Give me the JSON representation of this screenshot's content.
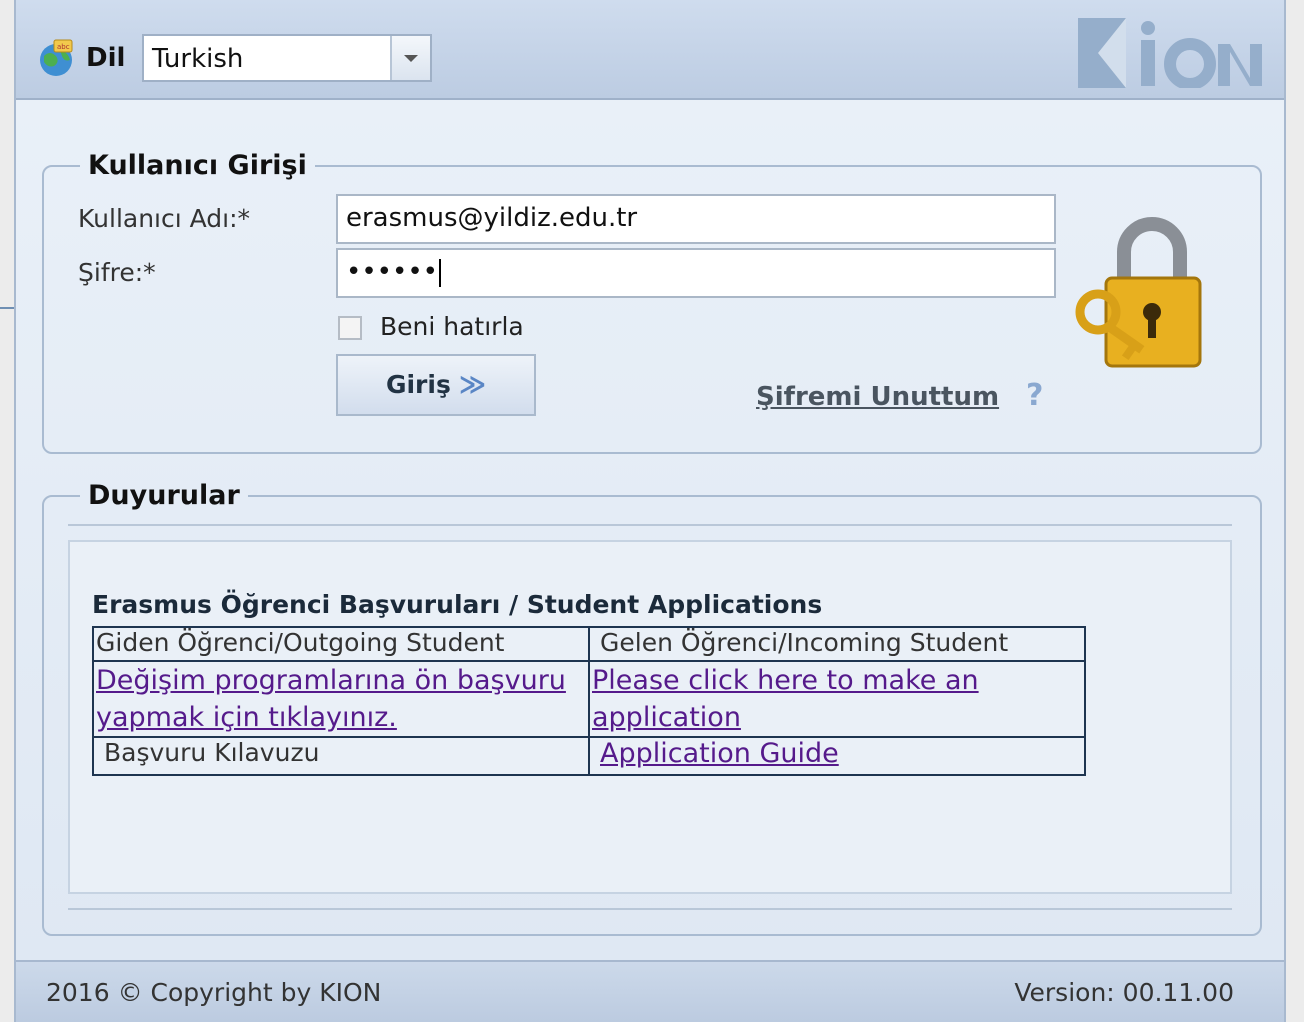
{
  "header": {
    "language_label": "Dil",
    "language_value": "Turkish",
    "logo_text": "KION"
  },
  "login": {
    "legend": "Kullanıcı Girişi",
    "username_label": "Kullanıcı Adı:*",
    "username_value": "erasmus@yildiz.edu.tr",
    "password_label": "Şifre:*",
    "password_value": "••••••",
    "remember_label": "Beni hatırla",
    "remember_checked": false,
    "submit_label": "Giriş",
    "forgot_label": "Şifremi Unuttum",
    "help_icon": "?"
  },
  "announcements": {
    "legend": "Duyurular",
    "title": "Erasmus Öğrenci Başvuruları / Student Applications",
    "table": {
      "header_left": "Giden Öğrenci/Outgoing Student",
      "header_right": "Gelen Öğrenci/Incoming Student",
      "link_left": "Değişim programlarına ön başvuru yapmak için tıklayınız.",
      "link_right": "Please click here to make an application",
      "guide_left": "Başvuru Kılavuzu",
      "guide_right": "Application Guide"
    }
  },
  "footer": {
    "copyright": "2016 © Copyright by KION",
    "version": "Version: 00.11.00"
  }
}
